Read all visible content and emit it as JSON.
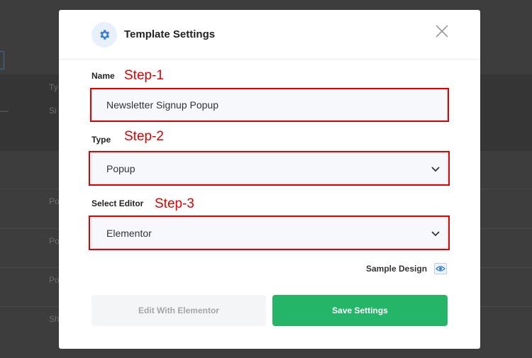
{
  "background": {
    "column_header": "Ty",
    "row_fragments": [
      "Si",
      "Po",
      "Po",
      "Po",
      "Sh"
    ]
  },
  "modal": {
    "title": "Template Settings",
    "icon": "gear-icon",
    "close_icon": "close-icon",
    "fields": {
      "name": {
        "label": "Name",
        "step": "Step-1",
        "value": "Newsletter Signup Popup"
      },
      "type": {
        "label": "Type",
        "step": "Step-2",
        "value": "Popup"
      },
      "editor": {
        "label": "Select Editor",
        "step": "Step-3",
        "value": "Elementor"
      }
    },
    "sample_design_label": "Sample Design",
    "sample_design_icon": "eye-icon",
    "buttons": {
      "edit": "Edit With Elementor",
      "save": "Save Settings"
    }
  },
  "colors": {
    "accent_green": "#24b568",
    "highlight_red": "#e00000",
    "icon_blue": "#3b7ddd"
  }
}
